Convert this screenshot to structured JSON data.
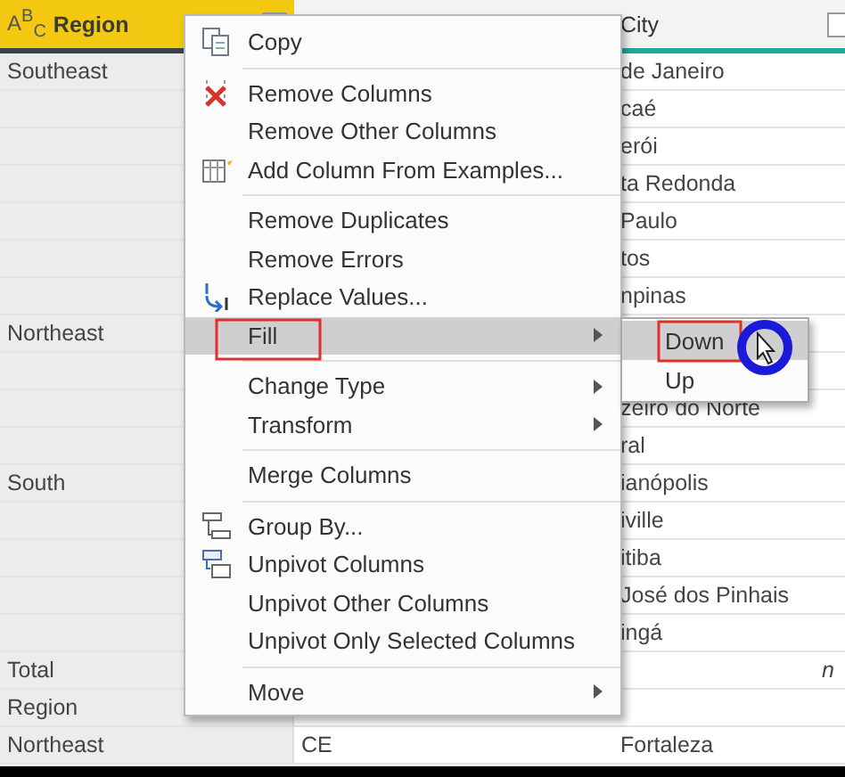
{
  "table": {
    "columns": [
      {
        "type_icon": "A$^{B}$$_{C}$",
        "title": "Region",
        "selected": true
      },
      {
        "selected": false
      },
      {
        "title": "City",
        "selected": false
      }
    ],
    "rows": [
      {
        "region": "Southeast",
        "city": "de Janeiro"
      },
      {
        "city": "caé"
      },
      {
        "city": "erói"
      },
      {
        "city": "ta Redonda"
      },
      {
        "city": "Paulo"
      },
      {
        "city": "tos"
      },
      {
        "city": "npinas"
      },
      {
        "region": "Northeast"
      },
      {},
      {
        "city": "zeiro do Norte"
      },
      {
        "city": "ral"
      },
      {
        "region": "South",
        "city": "ianópolis"
      },
      {
        "city": "iville"
      },
      {
        "city": "itiba"
      },
      {
        "city": "José dos Pinhais"
      },
      {
        "city": "ingá"
      },
      {
        "region": "Total",
        "city_note": "n"
      },
      {
        "region": "Region"
      },
      {
        "region": "Northeast",
        "column_2": "CE",
        "city": "Fortaleza"
      }
    ]
  },
  "context_menu": {
    "groups": [
      [
        {
          "label": "Copy",
          "submenu": false,
          "selected": false
        }
      ],
      [
        {
          "label": "Remove Columns",
          "submenu": false,
          "selected": false
        },
        {
          "label": "Remove Other Columns",
          "submenu": false,
          "selected": false
        },
        {
          "label": "Add Column From Examples...",
          "submenu": false,
          "selected": false
        }
      ],
      [
        {
          "label": "Remove Duplicates",
          "submenu": false,
          "selected": false
        },
        {
          "label": "Remove Errors",
          "submenu": false,
          "selected": false
        },
        {
          "label": "Replace Values...",
          "submenu": false,
          "selected": false
        },
        {
          "label": "Fill",
          "submenu": true,
          "selected": true
        }
      ],
      [
        {
          "label": "Change Type",
          "submenu": true,
          "selected": false
        },
        {
          "label": "Transform",
          "submenu": true,
          "selected": false
        }
      ],
      [
        {
          "label": "Merge Columns",
          "submenu": false,
          "selected": false
        }
      ],
      [
        {
          "label": "Group By...",
          "submenu": false,
          "selected": false
        },
        {
          "label": "Unpivot Columns",
          "submenu": false,
          "selected": false
        },
        {
          "label": "Unpivot Other Columns",
          "submenu": false,
          "selected": false
        },
        {
          "label": "Unpivot Only Selected Columns",
          "submenu": false,
          "selected": false
        }
      ],
      [
        {
          "label": "Move",
          "submenu": true,
          "selected": false
        }
      ]
    ]
  },
  "submenu": {
    "items": [
      {
        "label": "Down",
        "selected": true
      },
      {
        "label": "Up",
        "selected": false
      }
    ]
  }
}
